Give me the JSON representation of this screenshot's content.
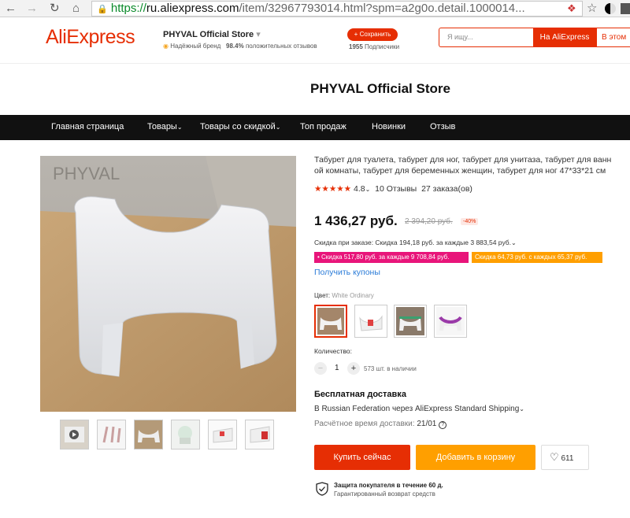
{
  "browser": {
    "url_scheme": "https://",
    "url_domain": "ru.aliexpress.com",
    "url_path": "/item/32967793014.html?spm=a2g0o.detail.1000014..."
  },
  "header": {
    "logo": "AliExpress",
    "store_name": "PHYVAL Official Store",
    "trusted_brand": "Надёжный бренд",
    "positive_pct": "98.4%",
    "positive_label": "положительных отзывов",
    "save_button": "+ Сохранить",
    "subscribers_count": "1955",
    "subscribers_label": "Подписчики",
    "search_placeholder": "Я ищу...",
    "search_aliexpress": "На AliExpress",
    "search_store": "В этом"
  },
  "store_title": "PHYVAL Official Store",
  "nav": {
    "items": [
      "Главная страница",
      "Товары",
      "Товары со скидкой",
      "Топ продаж",
      "Новинки",
      "Отзыв"
    ]
  },
  "product": {
    "watermark": "PHYVAL",
    "title_line1": "Табурет для туалета, табурет для ног, табурет для унитаза, табурет для ванн",
    "title_line2": "ой комнаты, табурет для беременных женщин, табурет для ног 47*33*21 см",
    "rating": "4.8",
    "reviews": "10 Отзывы",
    "orders": "27 заказа(ов)",
    "price": "1 436,27 руб.",
    "old_price": "2 394,20 руб.",
    "discount": "-40%",
    "bulk_discount": "Скидка при заказе: Скидка 194,18 руб. за каждые 3 883,54 руб.",
    "coupon1": "• Скидка 517,80 руб. за каждые 9 708,84 руб.",
    "coupon2": "Скидка 64,73 руб. с каждых 65,37 руб.",
    "get_coupons": "Получить купоны",
    "color_label": "Цвет:",
    "color_value": "White Ordinary",
    "qty_label": "Количество:",
    "qty_minus": "−",
    "qty_value": "1",
    "qty_plus": "+",
    "stock": "573 шт. в наличии",
    "shipping_title": "Бесплатная доставка",
    "shipping_line": "В Russian Federation через AliExpress Standard Shipping",
    "delivery_label": "Расчётное время доставки:",
    "delivery_date": "21/01",
    "buy_now": "Купить сейчас",
    "add_to_cart": "Добавить в корзину",
    "wishlist_count": "611",
    "protection_title": "Защита покупателя в течение 60 д.",
    "protection_sub": "Гарантированный возврат средств"
  },
  "colors": {
    "brand_red": "#e62e04",
    "orange": "#ff9f00",
    "coupon_pink": "#e8157a",
    "link_blue": "#2a7bd8"
  }
}
